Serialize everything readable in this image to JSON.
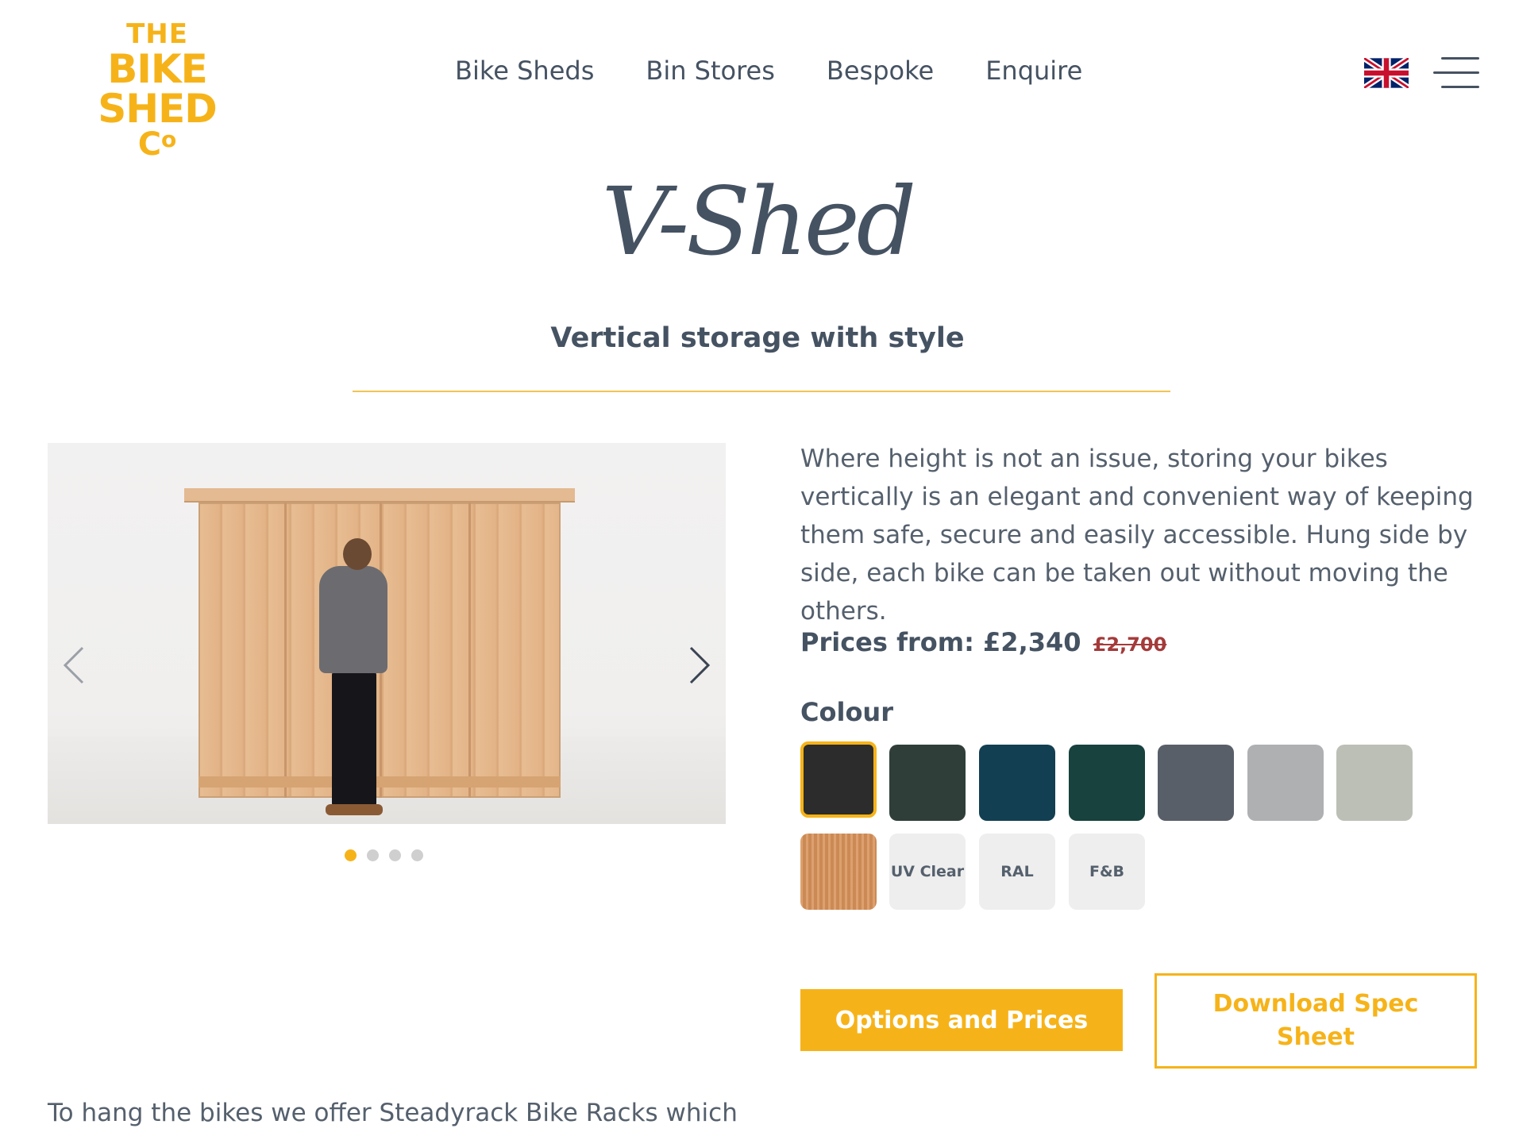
{
  "brand": {
    "line1": "THE",
    "line2": "BIKE SHED",
    "line3": "C",
    "line3_sup": "o"
  },
  "nav": [
    "Bike Sheds",
    "Bin Stores",
    "Bespoke",
    "Enquire"
  ],
  "header_icons": {
    "flag": "uk-flag-icon",
    "menu": "hamburger-menu-icon"
  },
  "hero": {
    "title": "V-Shed",
    "subtitle": "Vertical storage with style"
  },
  "carousel": {
    "slides": 4,
    "active_slide": 1,
    "prev": "chevron-left-icon",
    "next": "chevron-right-icon"
  },
  "product": {
    "description": "Where height is not an issue, storing your bikes vertically is an elegant and convenient way of keeping them safe, secure and easily accessible. Hung side by side, each bike can be taken out without moving the others.",
    "price_label": "Prices from: £2,340",
    "price_old": "£2,700",
    "colour_label": "Colour"
  },
  "swatches": [
    {
      "id": "charcoal",
      "color": "#2c2c2c",
      "selected": true
    },
    {
      "id": "dark-green-grain",
      "color": "#2f3e39"
    },
    {
      "id": "petrol-blue",
      "color": "#123f52"
    },
    {
      "id": "forest-green",
      "color": "#17423e"
    },
    {
      "id": "slate-grey",
      "color": "#595f69"
    },
    {
      "id": "light-grey",
      "color": "#aeb0b2"
    },
    {
      "id": "pale-grey-green",
      "color": "#bcbfb6"
    },
    {
      "id": "natural-larch",
      "color": "#d8935a"
    }
  ],
  "text_swatches": [
    "UV Clear",
    "RAL",
    "F&B"
  ],
  "buttons": {
    "primary": "Options and Prices",
    "secondary": "Download Spec Sheet"
  },
  "bottom_text": "To hang the bikes we offer Steadyrack Bike Racks which"
}
